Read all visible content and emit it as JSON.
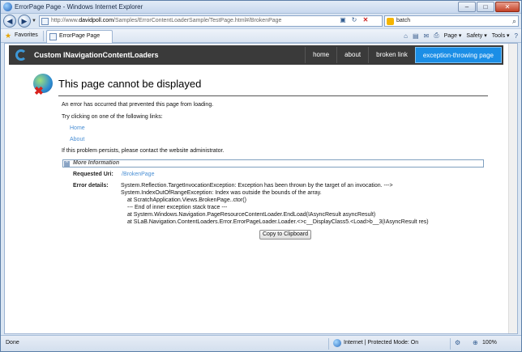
{
  "window": {
    "title": "ErrorPage Page - Windows Internet Explorer",
    "buttons": {
      "minimize": "–",
      "maximize": "□",
      "close": "✕"
    }
  },
  "address_bar": {
    "url_prefix": "http://www.",
    "url_domain": "davidpoll.com",
    "url_rest": "/Samples/ErrorContentLoaderSample/TestPage.html#/BrokenPage",
    "search_value": "batch"
  },
  "favorites_bar": {
    "favorites_label": "Favorites",
    "tab_label": "ErrorPage Page",
    "commands": [
      "Page ▾",
      "Safety ▾",
      "Tools ▾"
    ]
  },
  "site": {
    "title": "Custom INavigationContentLoaders",
    "nav": [
      {
        "label": "home",
        "active": false
      },
      {
        "label": "about",
        "active": false
      },
      {
        "label": "broken link",
        "active": false
      },
      {
        "label": "exception-throwing page",
        "active": true
      }
    ]
  },
  "error": {
    "heading": "This page cannot be displayed",
    "message": "An error has occurred that prevented this page from loading.",
    "try_links_text": "Try clicking on one of the following links:",
    "links": [
      "Home",
      "About"
    ],
    "persist_text": "If this problem persists, please contact the website administrator.",
    "more_info_label": "More Information",
    "requested_uri_label": "Requested Uri:",
    "requested_uri_value": "/BrokenPage",
    "error_details_label": "Error details:",
    "error_details_lines": [
      "System.Reflection.TargetInvocationException: Exception has been thrown by the target of an invocation. --->",
      "System.IndexOutOfRangeException: Index was outside the bounds of the array.",
      "   at ScratchApplication.Views.BrokenPage..ctor()",
      "   --- End of inner exception stack trace ---",
      "   at System.Windows.Navigation.PageResourceContentLoader.EndLoad(IAsyncResult asyncResult)",
      "   at SLaB.Navigation.ContentLoaders.Error.ErrorPageLoader.Loader.<>c__DisplayClass5.<Load>b__3(IAsyncResult res)"
    ],
    "copy_button": "Copy to Clipboard"
  },
  "status_bar": {
    "status": "Done",
    "zone": "Internet | Protected Mode: On",
    "zoom": "100%"
  }
}
